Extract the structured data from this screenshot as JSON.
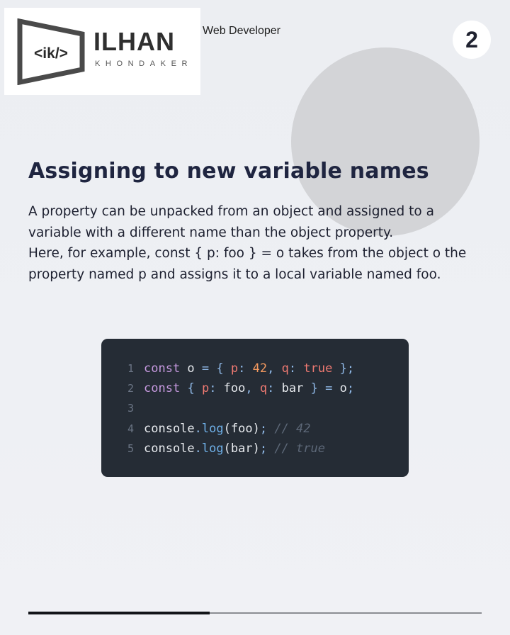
{
  "header": {
    "logo": {
      "icon_name": "code-tag-logo",
      "mark_text": "<ik/>",
      "name": "ILHAN",
      "subtitle": "KHONDAKER"
    },
    "role": "Web Developer",
    "page_number": "2"
  },
  "content": {
    "title": "Assigning to new variable names",
    "paragraphs": [
      "A property can be unpacked from an object and assigned to a variable with a different name than the object property.",
      "Here, for example, const { p: foo } = o takes from the object o the property named p and assigns it to a local variable named foo."
    ]
  },
  "code": {
    "line_numbers": [
      "1",
      "2",
      "3",
      "4",
      "5"
    ],
    "lines": [
      [
        {
          "t": "kw",
          "v": "const"
        },
        {
          "t": "plain",
          "v": " o "
        },
        {
          "t": "punc",
          "v": "="
        },
        {
          "t": "plain",
          "v": " "
        },
        {
          "t": "punc",
          "v": "{"
        },
        {
          "t": "plain",
          "v": " "
        },
        {
          "t": "prop",
          "v": "p"
        },
        {
          "t": "punc",
          "v": ":"
        },
        {
          "t": "plain",
          "v": " "
        },
        {
          "t": "num",
          "v": "42"
        },
        {
          "t": "punc",
          "v": ","
        },
        {
          "t": "plain",
          "v": " "
        },
        {
          "t": "prop",
          "v": "q"
        },
        {
          "t": "punc",
          "v": ":"
        },
        {
          "t": "plain",
          "v": " "
        },
        {
          "t": "bool",
          "v": "true"
        },
        {
          "t": "plain",
          "v": " "
        },
        {
          "t": "punc",
          "v": "};"
        }
      ],
      [
        {
          "t": "kw",
          "v": "const"
        },
        {
          "t": "plain",
          "v": " "
        },
        {
          "t": "punc",
          "v": "{"
        },
        {
          "t": "plain",
          "v": " "
        },
        {
          "t": "prop",
          "v": "p"
        },
        {
          "t": "punc",
          "v": ":"
        },
        {
          "t": "plain",
          "v": " foo"
        },
        {
          "t": "punc",
          "v": ","
        },
        {
          "t": "plain",
          "v": " "
        },
        {
          "t": "prop",
          "v": "q"
        },
        {
          "t": "punc",
          "v": ":"
        },
        {
          "t": "plain",
          "v": " bar "
        },
        {
          "t": "punc",
          "v": "}"
        },
        {
          "t": "plain",
          "v": " "
        },
        {
          "t": "punc",
          "v": "="
        },
        {
          "t": "plain",
          "v": " o"
        },
        {
          "t": "punc",
          "v": ";"
        }
      ],
      [],
      [
        {
          "t": "plain",
          "v": "console"
        },
        {
          "t": "punc",
          "v": "."
        },
        {
          "t": "fn",
          "v": "log"
        },
        {
          "t": "plain",
          "v": "(foo)"
        },
        {
          "t": "punc",
          "v": ";"
        },
        {
          "t": "plain",
          "v": " "
        },
        {
          "t": "com",
          "v": "// 42"
        }
      ],
      [
        {
          "t": "plain",
          "v": "console"
        },
        {
          "t": "punc",
          "v": "."
        },
        {
          "t": "fn",
          "v": "log"
        },
        {
          "t": "plain",
          "v": "(bar)"
        },
        {
          "t": "punc",
          "v": ";"
        },
        {
          "t": "plain",
          "v": " "
        },
        {
          "t": "com",
          "v": "// true"
        }
      ]
    ]
  },
  "progress": {
    "fraction": 0.4
  },
  "colors": {
    "background": "#eceef2",
    "title": "#1f2540",
    "code_bg": "#252c35",
    "circle": "#d3d4d7"
  }
}
